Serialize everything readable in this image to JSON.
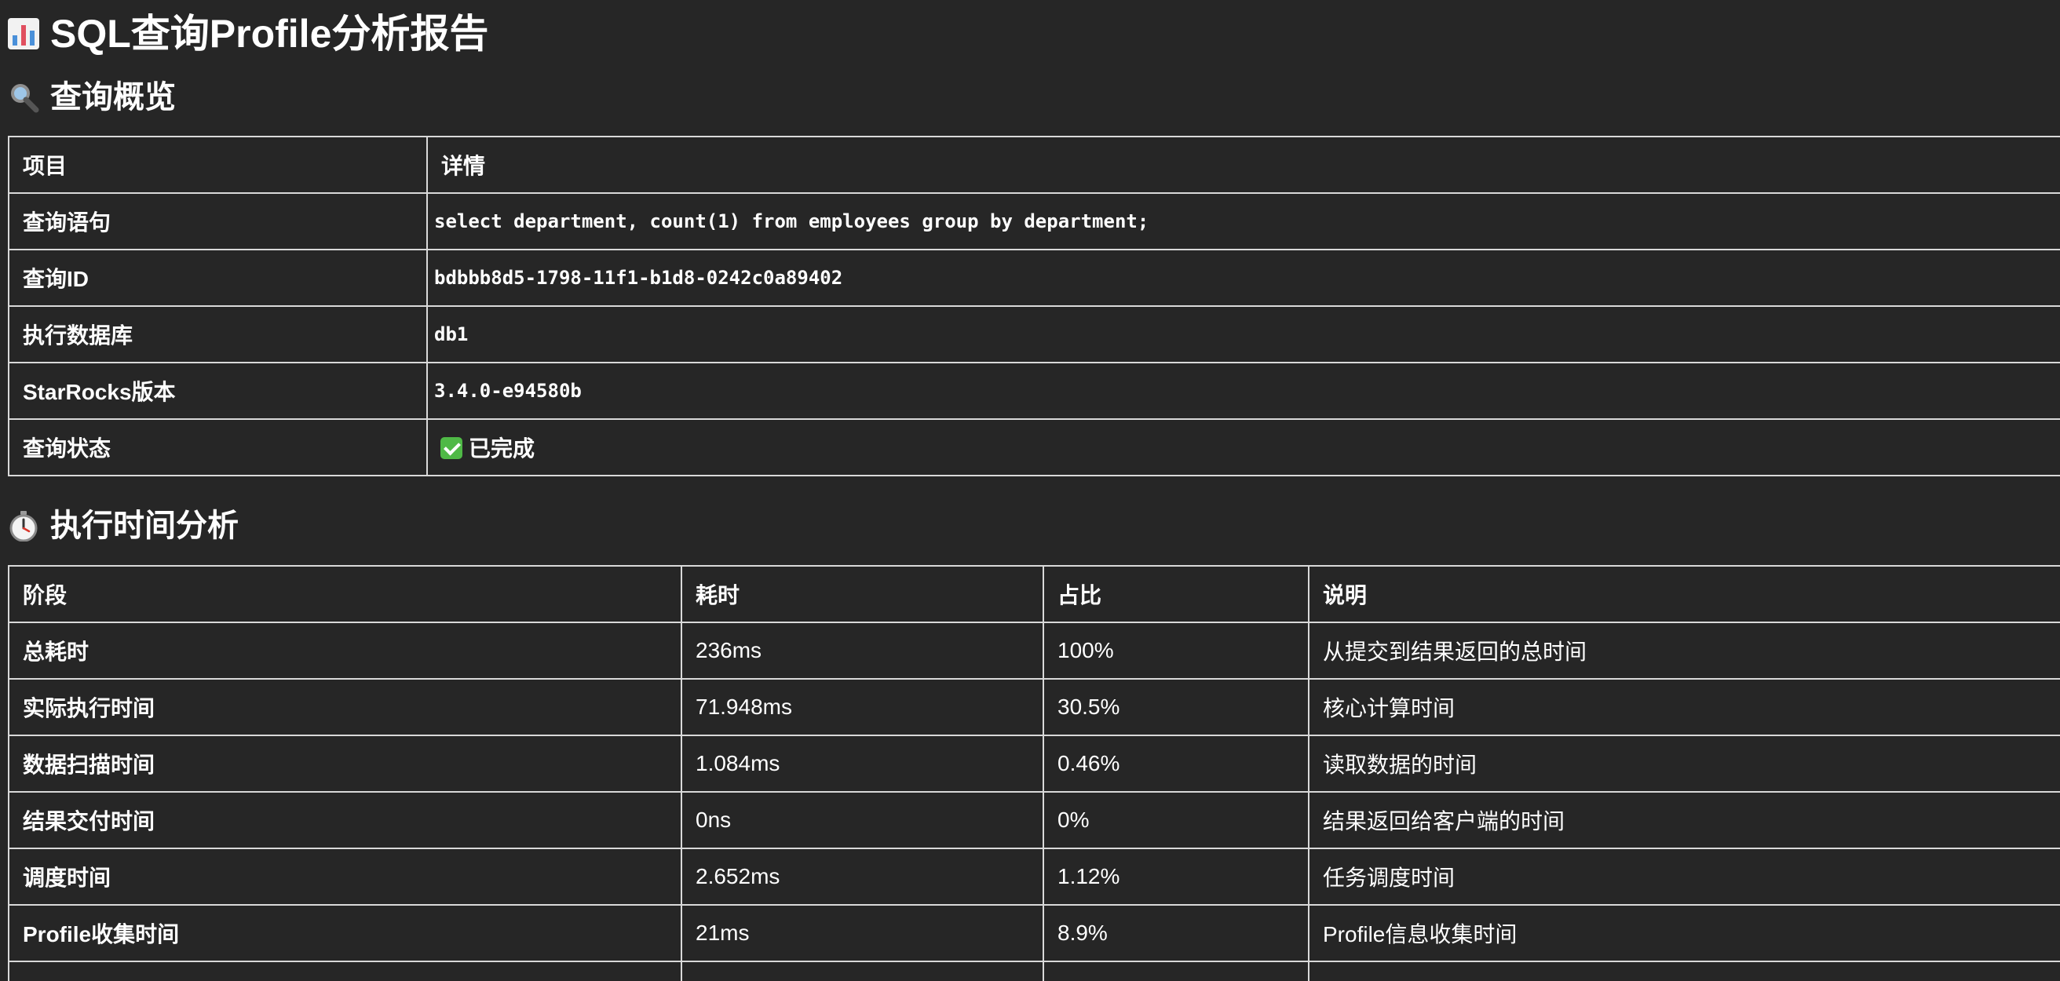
{
  "page": {
    "title": "SQL查询Profile分析报告"
  },
  "overview": {
    "heading": "查询概览",
    "headers": [
      "项目",
      "详情"
    ],
    "rows": [
      {
        "label": "查询语句",
        "value": "select department, count(1) from employees group by department;"
      },
      {
        "label": "查询ID",
        "value": "bdbbb8d5-1798-11f1-b1d8-0242c0a89402"
      },
      {
        "label": "执行数据库",
        "value": "db1"
      },
      {
        "label": "StarRocks版本",
        "value": "3.4.0-e94580b"
      },
      {
        "label": "查询状态",
        "value": "已完成"
      }
    ]
  },
  "timing": {
    "heading": "执行时间分析",
    "headers": [
      "阶段",
      "耗时",
      "占比",
      "说明"
    ],
    "rows": [
      {
        "stage": "总耗时",
        "time": "236ms",
        "ratio": "100%",
        "desc": "从提交到结果返回的总时间"
      },
      {
        "stage": "实际执行时间",
        "time": "71.948ms",
        "ratio": "30.5%",
        "desc": "核心计算时间"
      },
      {
        "stage": "数据扫描时间",
        "time": "1.084ms",
        "ratio": "0.46%",
        "desc": "读取数据的时间"
      },
      {
        "stage": "结果交付时间",
        "time": "0ns",
        "ratio": "0%",
        "desc": "结果返回给客户端的时间"
      },
      {
        "stage": "调度时间",
        "time": "2.652ms",
        "ratio": "1.12%",
        "desc": "任务调度时间"
      },
      {
        "stage": "Profile收集时间",
        "time": "21ms",
        "ratio": "8.9%",
        "desc": "Profile信息收集时间"
      }
    ]
  },
  "icons": {
    "title": "bar-chart-icon",
    "overview": "magnifier-icon",
    "timing": "stopwatch-icon",
    "status": "check-mark-icon"
  },
  "colors": {
    "background": "#262626",
    "text": "#ffffff",
    "border": "#d9d9d9",
    "check": "#4fb946"
  }
}
